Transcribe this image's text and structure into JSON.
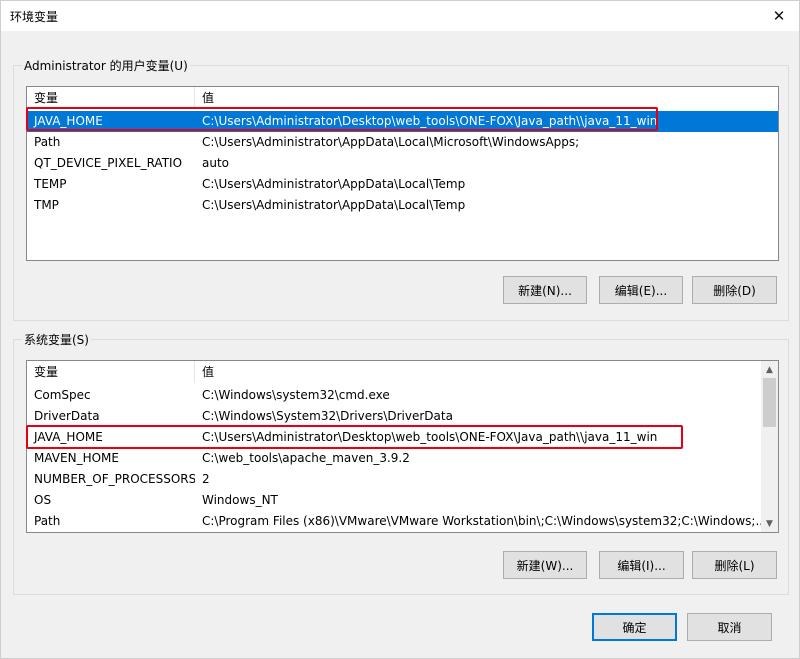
{
  "window": {
    "title": "环境变量",
    "close_glyph": "✕"
  },
  "user_vars": {
    "legend": "Administrator 的用户变量(U)",
    "columns": [
      "变量",
      "值"
    ],
    "rows": [
      {
        "name": "JAVA_HOME",
        "value": "C:\\Users\\Administrator\\Desktop\\web_tools\\ONE-FOX\\Java_path\\\\java_11_win"
      },
      {
        "name": "Path",
        "value": "C:\\Users\\Administrator\\AppData\\Local\\Microsoft\\WindowsApps;"
      },
      {
        "name": "QT_DEVICE_PIXEL_RATIO",
        "value": "auto"
      },
      {
        "name": "TEMP",
        "value": "C:\\Users\\Administrator\\AppData\\Local\\Temp"
      },
      {
        "name": "TMP",
        "value": "C:\\Users\\Administrator\\AppData\\Local\\Temp"
      }
    ],
    "buttons": {
      "new": "新建(N)...",
      "edit": "编辑(E)...",
      "delete": "删除(D)"
    }
  },
  "system_vars": {
    "legend": "系统变量(S)",
    "columns": [
      "变量",
      "值"
    ],
    "rows": [
      {
        "name": "ComSpec",
        "value": "C:\\Windows\\system32\\cmd.exe"
      },
      {
        "name": "DriverData",
        "value": "C:\\Windows\\System32\\Drivers\\DriverData"
      },
      {
        "name": "JAVA_HOME",
        "value": "C:\\Users\\Administrator\\Desktop\\web_tools\\ONE-FOX\\Java_path\\\\java_11_win"
      },
      {
        "name": "MAVEN_HOME",
        "value": "C:\\web_tools\\apache_maven_3.9.2"
      },
      {
        "name": "NUMBER_OF_PROCESSORS",
        "value": "2"
      },
      {
        "name": "OS",
        "value": "Windows_NT"
      },
      {
        "name": "Path",
        "value": "C:\\Program Files (x86)\\VMware\\VMware Workstation\\bin\\;C:\\Windows\\system32;C:\\Windows;..."
      }
    ],
    "buttons": {
      "new": "新建(W)...",
      "edit": "编辑(I)...",
      "delete": "删除(L)"
    }
  },
  "footer": {
    "ok": "确定",
    "cancel": "取消"
  },
  "colors": {
    "selection": "#0078d7",
    "highlight_box": "#e60012",
    "default_button_border": "#0078d7"
  },
  "icons": {
    "close": "close-icon",
    "scroll_up": "scroll-up-arrow-icon",
    "scroll_down": "scroll-down-arrow-icon"
  }
}
